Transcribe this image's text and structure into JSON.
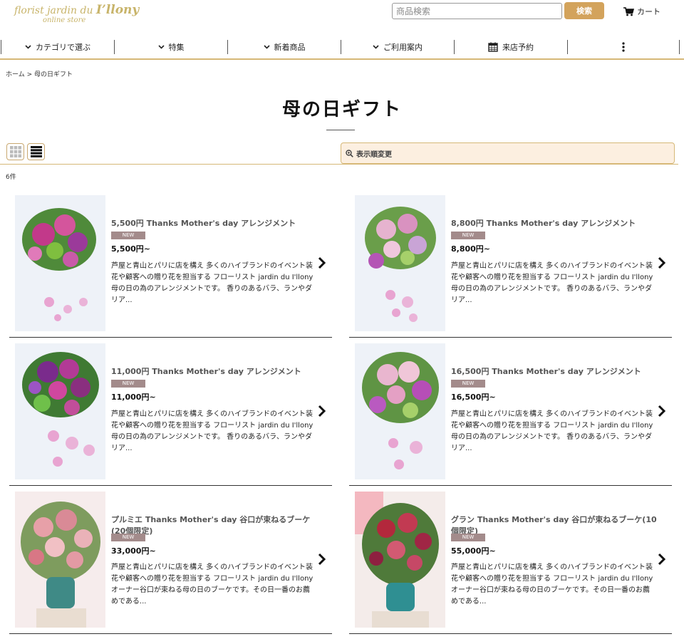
{
  "header": {
    "logo_line1_prefix": "florist jardin du ",
    "logo_line1_brand": "I’llony",
    "logo_line2": "online store",
    "search_placeholder": "商品検索",
    "search_button": "検索",
    "cart_label": "カート"
  },
  "nav": {
    "items": [
      {
        "label": "カテゴリで選ぶ",
        "icon": "chevron-down-icon"
      },
      {
        "label": "特集",
        "icon": "chevron-down-icon"
      },
      {
        "label": "新着商品",
        "icon": "chevron-down-icon"
      },
      {
        "label": "ご利用案内",
        "icon": "chevron-down-icon"
      },
      {
        "label": "来店予約",
        "icon": "calendar-icon"
      },
      {
        "label": "",
        "icon": "more-vertical-icon"
      }
    ]
  },
  "breadcrumb": {
    "home": "ホーム",
    "separator": ">",
    "current": "母の日ギフト"
  },
  "page": {
    "title": "母の日ギフト",
    "sort_label": "表示順変更",
    "count": "6件"
  },
  "colors": {
    "accent": "#d3a35c",
    "nav_rule": "#d6b877",
    "sort_bg": "#fcefe0",
    "badge": "#a38b8b"
  },
  "products": [
    {
      "name": "5,500円 Thanks Mother's day アレンジメント",
      "badge": "NEW",
      "price": "5,500円~",
      "description": "芦屋と青山とパリに店を構え 多くのハイブランドのイベント装花や顧客への贈り花を担当する フローリスト jardin du I'llony 母の日の為のアレンジメントです。 香りのあるバラ、ランやダリア..."
    },
    {
      "name": "8,800円 Thanks Mother's day アレンジメント",
      "badge": "NEW",
      "price": "8,800円~",
      "description": "芦屋と青山とパリに店を構え 多くのハイブランドのイベント装花や顧客への贈り花を担当する フローリスト jardin du I'llony 母の日の為のアレンジメントです。 香りのあるバラ、ランやダリア..."
    },
    {
      "name": "11,000円 Thanks Mother's day アレンジメント",
      "badge": "NEW",
      "price": "11,000円~",
      "description": "芦屋と青山とパリに店を構え 多くのハイブランドのイベント装花や顧客への贈り花を担当する フローリスト jardin du I'llony 母の日の為のアレンジメントです。 香りのあるバラ、ランやダリア..."
    },
    {
      "name": "16,500円 Thanks Mother's day アレンジメント",
      "badge": "NEW",
      "price": "16,500円~",
      "description": "芦屋と青山とパリに店を構え 多くのハイブランドのイベント装花や顧客への贈り花を担当する フローリスト jardin du I'llony 母の日の為のアレンジメントです。 香りのあるバラ、ランやダリア..."
    },
    {
      "name": "プルミエ Thanks Mother's day 谷口が束ねるブーケ(20個限定)",
      "badge": "NEW",
      "price": "33,000円~",
      "description": "芦屋と青山とパリに店を構え 多くのハイブランドのイベント装花や顧客への贈り花を担当する フローリスト jardin du I'llonyオーナー谷口が束ねる母の日のブーケです。その日一番のお薦めである..."
    },
    {
      "name": "グラン Thanks Mother's day 谷口が束ねるブーケ(10個限定)",
      "badge": "NEW",
      "price": "55,000円~",
      "description": "芦屋と青山とパリに店を構え 多くのハイブランドのイベント装花や顧客への贈り花を担当する フローリスト jardin du I'llonyオーナー谷口が束ねる母の日のブーケです。その日一番のお薦めである..."
    }
  ]
}
